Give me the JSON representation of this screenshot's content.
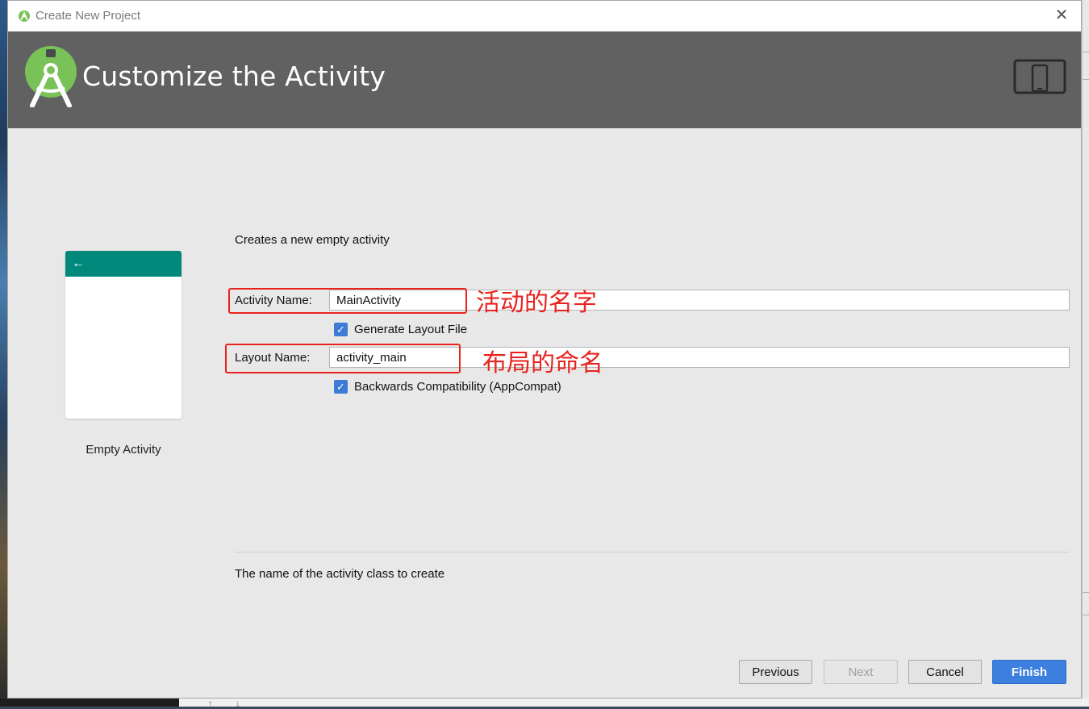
{
  "window": {
    "title": "Create New Project",
    "close_icon": "close-icon",
    "app_icon": "android-studio-icon"
  },
  "header": {
    "heading": "Customize the Activity",
    "logo_icon": "android-studio-logo-icon",
    "form_factor_icon": "tablet-phone-icon"
  },
  "preview": {
    "back_icon": "back-arrow-icon",
    "appbar_color": "#00897b",
    "template_name": "Empty Activity"
  },
  "form": {
    "description": "Creates a new empty activity",
    "activity_name": {
      "label": "Activity Name:",
      "value": "MainActivity"
    },
    "generate_layout": {
      "label": "Generate Layout File",
      "checked": true
    },
    "layout_name": {
      "label": "Layout Name:",
      "value": "activity_main"
    },
    "backwards_compat": {
      "label": "Backwards Compatibility (AppCompat)",
      "checked": true
    },
    "help_text": "The name of the activity class to create"
  },
  "annotations": {
    "activity_name_note": "活动的名字",
    "layout_name_note": "布局的命名",
    "highlight_color": "#e8231f"
  },
  "buttons": {
    "previous": "Previous",
    "next": "Next",
    "cancel": "Cancel",
    "finish": "Finish",
    "primary_color": "#3d7fdf"
  }
}
